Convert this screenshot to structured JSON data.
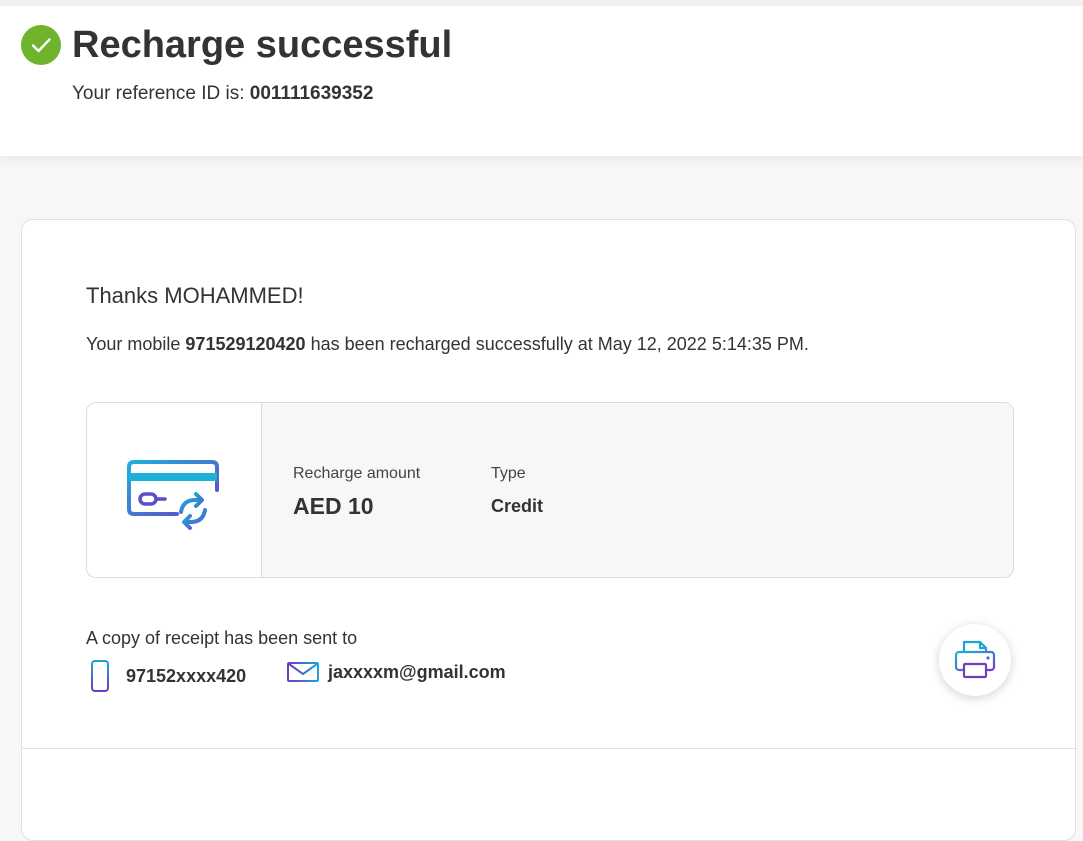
{
  "header": {
    "title": "Recharge successful",
    "reference_prefix": "Your reference ID is:",
    "reference_id": "001111639352"
  },
  "greeting": {
    "thanks": "Thanks MOHAMMED!",
    "msg_prefix": "Your mobile",
    "mobile_number": "971529120420",
    "msg_suffix": "has been recharged successfully at May 12, 2022 5:14:35 PM."
  },
  "details": {
    "icon": "card-exchange-icon",
    "amount_label": "Recharge amount",
    "amount_value": "AED 10",
    "type_label": "Type",
    "type_value": "Credit"
  },
  "receipt": {
    "label": "A copy of receipt has been sent to",
    "phone": "97152xxxx420",
    "email": "jaxxxxm@gmail.com",
    "print_icon": "printer-icon"
  },
  "colors": {
    "success_green": "#6fb42c",
    "accent_blue": "#1fa3d6",
    "accent_purple": "#6a3fc4"
  }
}
